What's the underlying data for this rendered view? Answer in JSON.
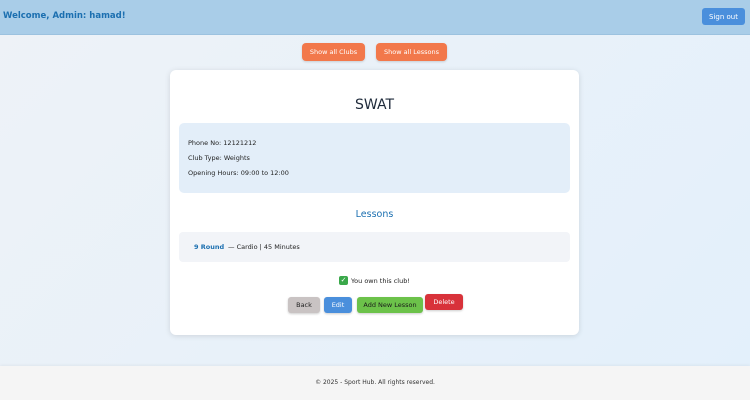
{
  "header": {
    "welcome_text": "Welcome, Admin: hamad!",
    "signout_label": "Sign out"
  },
  "nav": {
    "show_clubs_label": "Show all Clubs",
    "show_lessons_label": "Show all Lessons"
  },
  "club": {
    "name": "SWAT",
    "phone": "Phone No: 12121212",
    "type": "Club Type: Weights",
    "hours": "Opening Hours: 09:00 to 12:00"
  },
  "lessons": {
    "heading": "Lessons",
    "items": [
      {
        "name": "9 Round",
        "detail": "— Cardio | 45 Minutes"
      }
    ]
  },
  "ownership": {
    "text": "You own this club!"
  },
  "actions": {
    "back_label": "Back",
    "edit_label": "Edit",
    "add_lesson_label": "Add New Lesson",
    "delete_label": "Delete"
  },
  "footer": {
    "text": "© 2025 - Sport Hub. All rights reserved."
  },
  "colors": {
    "header_bg": "#a9cde8",
    "accent_blue": "#1b6fb0",
    "nav_orange": "#f2784b",
    "add_green": "#6cc24a",
    "delete_red": "#d8323a",
    "edit_blue": "#4a8fdc"
  }
}
